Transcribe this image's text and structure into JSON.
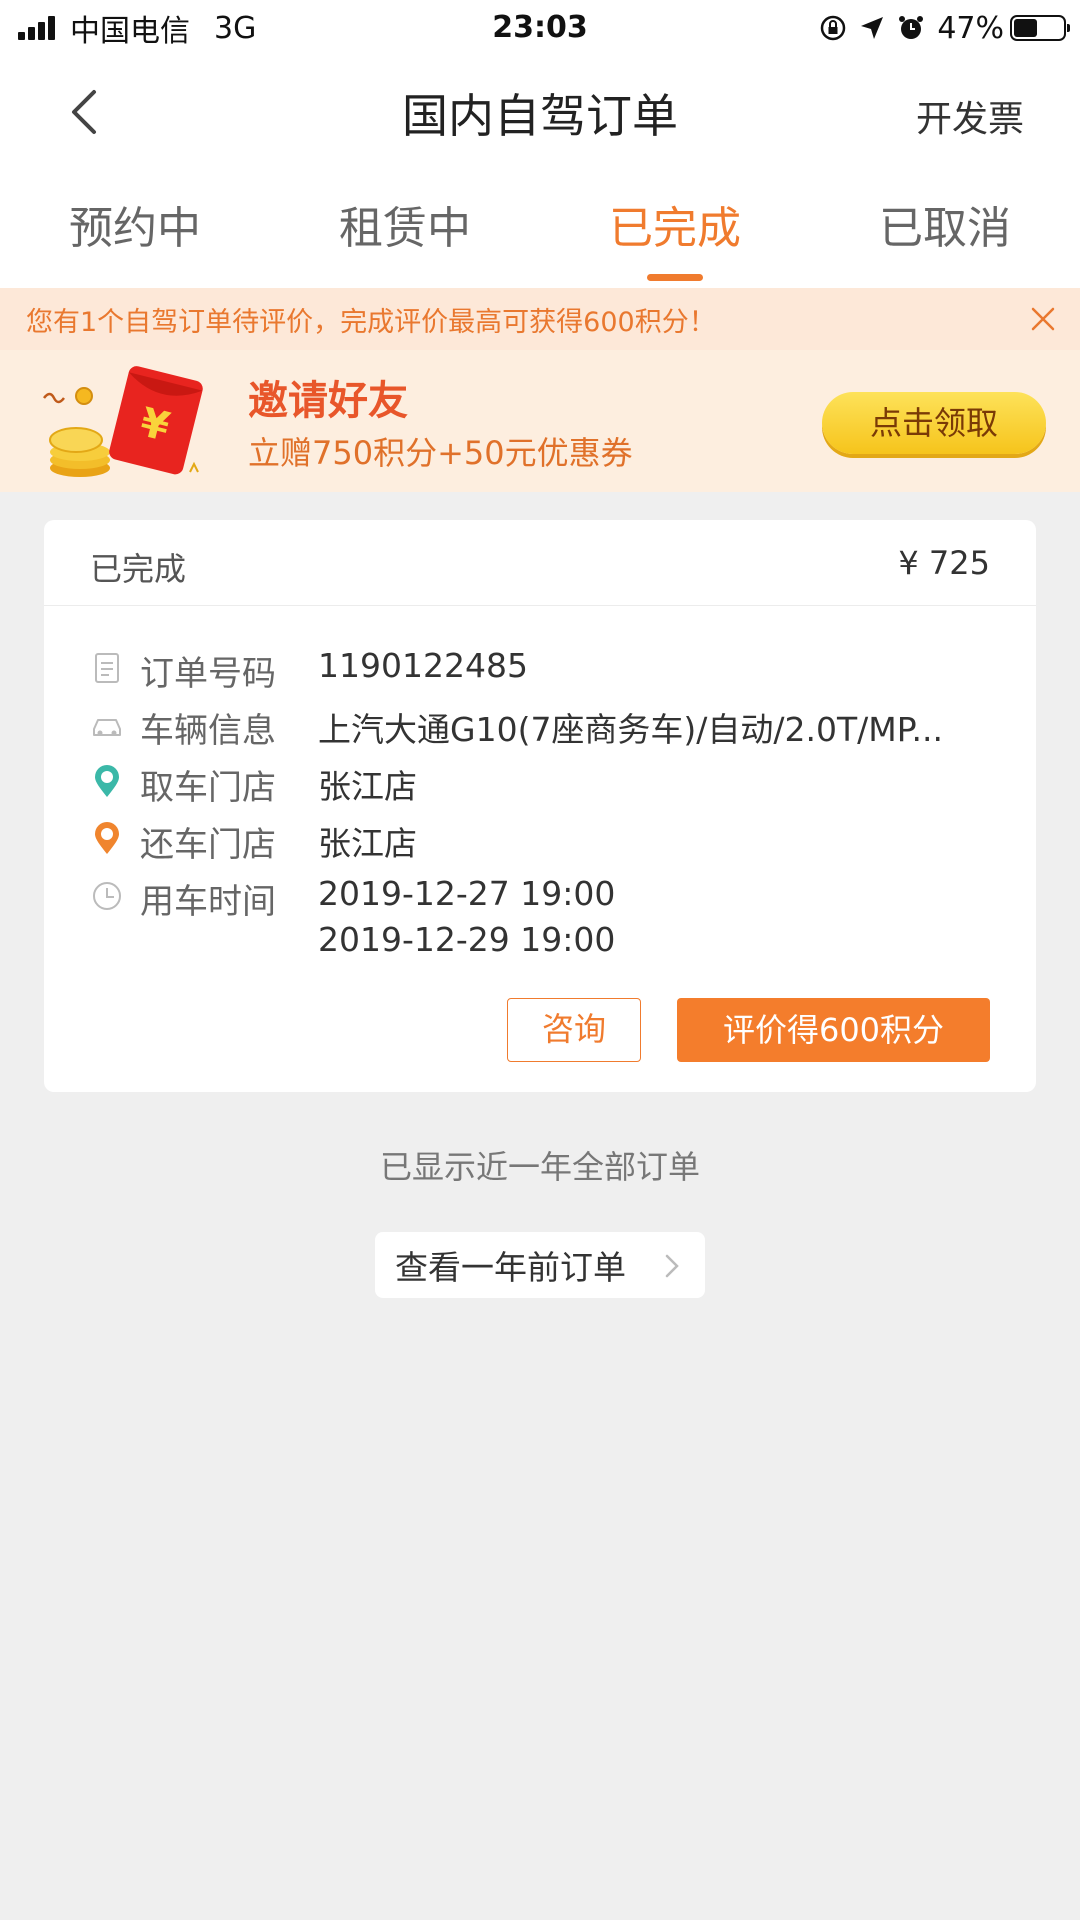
{
  "status_bar": {
    "carrier": "中国电信",
    "network": "3G",
    "time": "23:03",
    "battery": "47%",
    "battery_level": 0.47
  },
  "nav": {
    "title": "国内自驾订单",
    "invoice_label": "开发票"
  },
  "tabs": [
    {
      "label": "预约中"
    },
    {
      "label": "租赁中"
    },
    {
      "label": "已完成",
      "active": true
    },
    {
      "label": "已取消"
    }
  ],
  "notice": {
    "text": "您有1个自驾订单待评价，完成评价最高可获得600积分！"
  },
  "invite": {
    "title": "邀请好友",
    "subtitle": "立赠750积分+50元优惠券",
    "button_label": "点击领取"
  },
  "order": {
    "status": "已完成",
    "price": "¥ 725",
    "rows": [
      {
        "label": "订单号码",
        "value": "1190122485"
      },
      {
        "label": "车辆信息",
        "value": "上汽大通G10(7座商务车)/自动/2.0T/MP..."
      },
      {
        "label": "取车门店",
        "value": "张江店"
      },
      {
        "label": "还车门店",
        "value": "张江店"
      },
      {
        "label": "用车时间",
        "value": "2019-12-27 19:00",
        "value2": "2019-12-29 19:00"
      }
    ],
    "consult_label": "咨询",
    "review_label": "评价得600积分"
  },
  "footer": {
    "shown_note": "已显示近一年全部订单",
    "older_label": "查看一年前订单"
  },
  "colors": {
    "accent": "#f07b2e",
    "notice_bg": "#fde8d8",
    "invite_bg": "#fdeedf",
    "page_bg": "#efefef"
  }
}
